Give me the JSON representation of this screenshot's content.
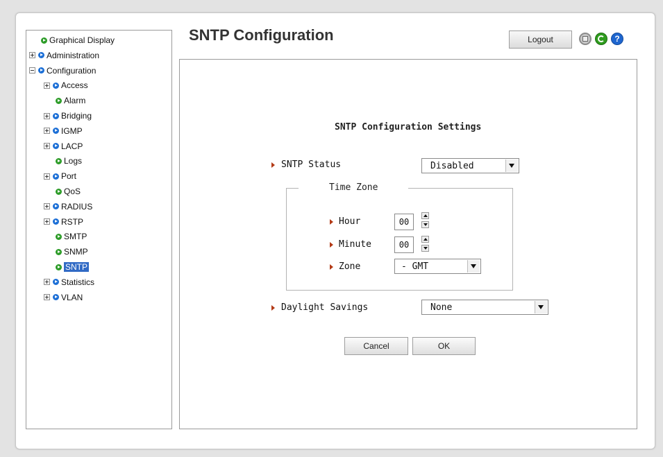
{
  "sidebar": {
    "items": [
      {
        "label": "Graphical Display",
        "expander": "none",
        "color": "green",
        "selected": false
      },
      {
        "label": "Administration",
        "expander": "plus",
        "color": "blue",
        "selected": false
      },
      {
        "label": "Configuration",
        "expander": "minus",
        "color": "blue",
        "selected": false
      },
      {
        "label": "Access",
        "expander": "plus",
        "color": "blue",
        "selected": false
      },
      {
        "label": "Alarm",
        "expander": "none",
        "color": "green",
        "selected": false
      },
      {
        "label": "Bridging",
        "expander": "plus",
        "color": "blue",
        "selected": false
      },
      {
        "label": "IGMP",
        "expander": "plus",
        "color": "blue",
        "selected": false
      },
      {
        "label": "LACP",
        "expander": "plus",
        "color": "blue",
        "selected": false
      },
      {
        "label": "Logs",
        "expander": "none",
        "color": "green",
        "selected": false
      },
      {
        "label": "Port",
        "expander": "plus",
        "color": "blue",
        "selected": false
      },
      {
        "label": "QoS",
        "expander": "none",
        "color": "green",
        "selected": false
      },
      {
        "label": "RADIUS",
        "expander": "plus",
        "color": "blue",
        "selected": false
      },
      {
        "label": "RSTP",
        "expander": "plus",
        "color": "blue",
        "selected": false
      },
      {
        "label": "SMTP",
        "expander": "none",
        "color": "green",
        "selected": false
      },
      {
        "label": "SNMP",
        "expander": "none",
        "color": "green",
        "selected": false
      },
      {
        "label": "SNTP",
        "expander": "none",
        "color": "green",
        "selected": true
      },
      {
        "label": "Statistics",
        "expander": "plus",
        "color": "blue",
        "selected": false
      },
      {
        "label": "VLAN",
        "expander": "plus",
        "color": "blue",
        "selected": false
      }
    ]
  },
  "header": {
    "title": "SNTP Configuration",
    "logout_label": "Logout",
    "icons": [
      "save-icon",
      "refresh-icon",
      "help-icon"
    ],
    "help_glyph": "?"
  },
  "form": {
    "title": "SNTP Configuration Settings",
    "sntp_status": {
      "label": "SNTP Status",
      "value": "Disabled"
    },
    "time_zone": {
      "legend": "Time Zone",
      "hour": {
        "label": "Hour",
        "value": "00"
      },
      "minute": {
        "label": "Minute",
        "value": "00"
      },
      "zone": {
        "label": "Zone",
        "value": "- GMT"
      }
    },
    "daylight_savings": {
      "label": "Daylight Savings",
      "value": "None"
    },
    "cancel_label": "Cancel",
    "ok_label": "OK"
  },
  "colors": {
    "accent_blue": "#1c6fd6",
    "accent_green": "#2d9c28",
    "selection": "#316ac5",
    "label_arrow": "#b33a16"
  }
}
